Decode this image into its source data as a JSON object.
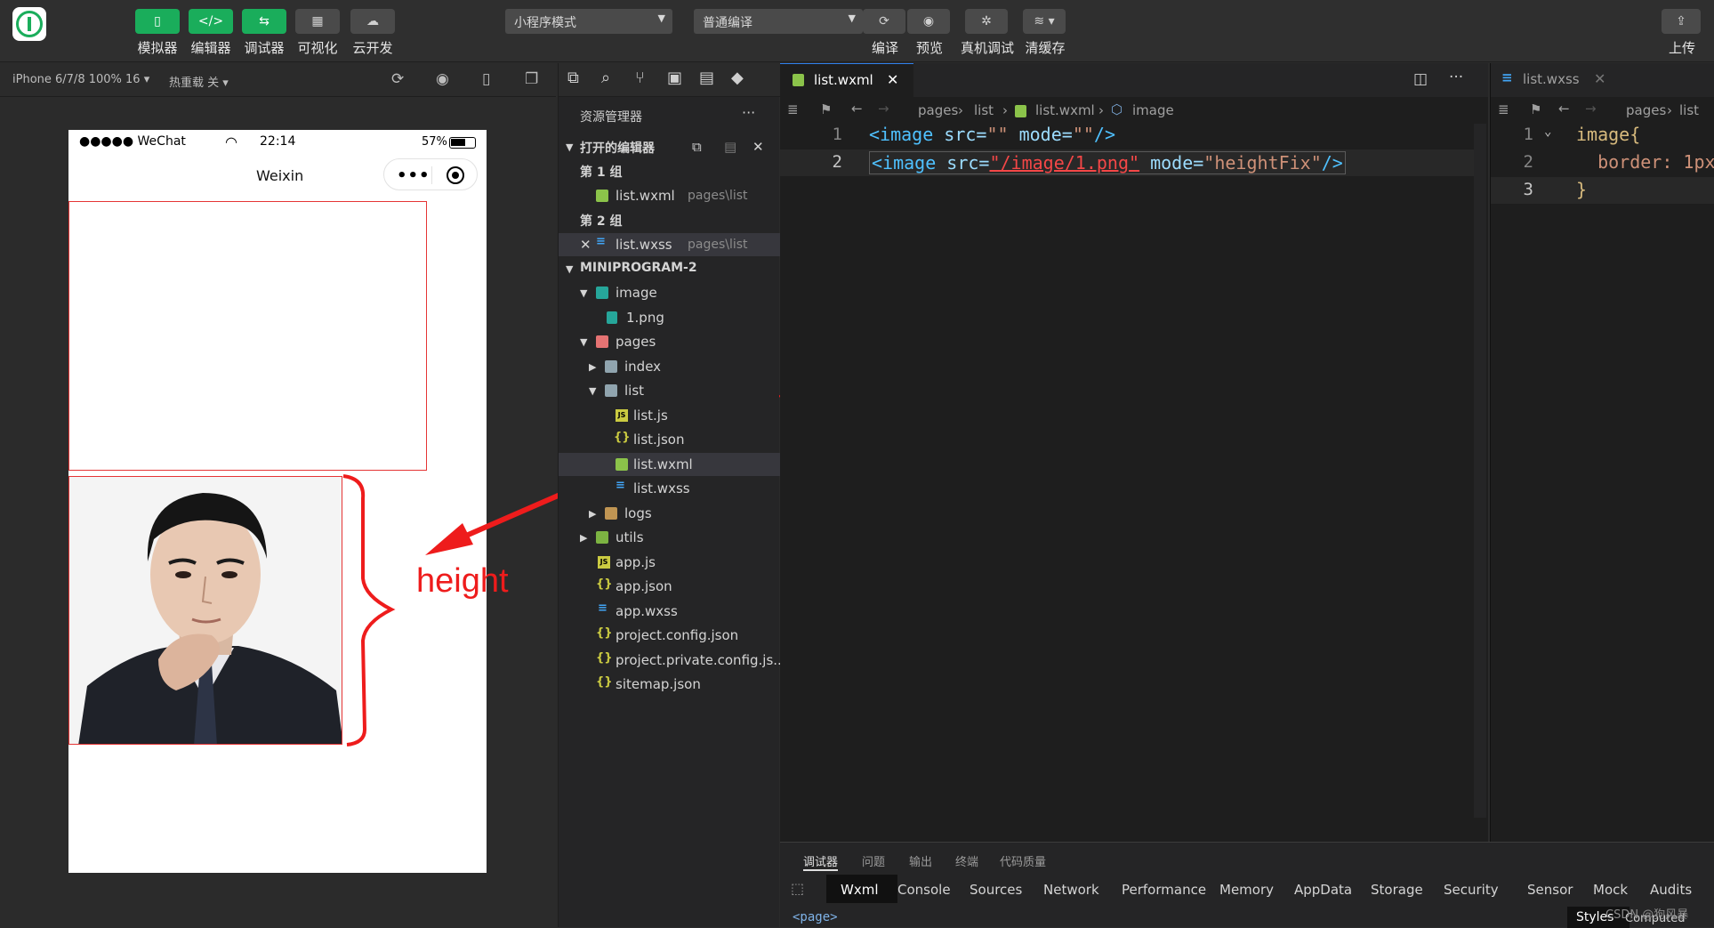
{
  "toolbar": {
    "buttons": [
      {
        "label": "模拟器",
        "icon": "phone-icon"
      },
      {
        "label": "编辑器",
        "icon": "code-icon"
      },
      {
        "label": "调试器",
        "icon": "debug-icon"
      },
      {
        "label": "可视化",
        "icon": "layout-icon"
      },
      {
        "label": "云开发",
        "icon": "cloud-icon"
      }
    ],
    "mode_select": "小程序模式",
    "compile_select": "普通编译",
    "actions": [
      {
        "label": "编译",
        "icon": "refresh-icon"
      },
      {
        "label": "预览",
        "icon": "eye-icon"
      },
      {
        "label": "真机调试",
        "icon": "bug-icon"
      },
      {
        "label": "清缓存",
        "icon": "layers-icon"
      }
    ],
    "upload_label": "上传"
  },
  "subbar": {
    "device": "iPhone 6/7/8 100% 16",
    "hot_reload": "热重载 关"
  },
  "simulator": {
    "signal": "●●●●● WeChat",
    "time": "22:14",
    "battery": "57%",
    "nav_title": "Weixin",
    "annotation_text": "height"
  },
  "explorer": {
    "title": "资源管理器",
    "more": "···",
    "open_editors": "打开的编辑器",
    "group1": "第 1 组",
    "group1_file": "list.wxml",
    "group1_path": "pages\\list",
    "group2": "第 2 组",
    "group2_file": "list.wxss",
    "group2_path": "pages\\list",
    "project": "MINIPROGRAM-2",
    "tree": [
      {
        "name": "image",
        "kind": "folder-img"
      },
      {
        "name": "1.png",
        "kind": "img"
      },
      {
        "name": "pages",
        "kind": "folder-red"
      },
      {
        "name": "index",
        "kind": "folder-blue"
      },
      {
        "name": "list",
        "kind": "folder-blue"
      },
      {
        "name": "list.js",
        "kind": "js"
      },
      {
        "name": "list.json",
        "kind": "json"
      },
      {
        "name": "list.wxml",
        "kind": "wxml"
      },
      {
        "name": "list.wxss",
        "kind": "css"
      },
      {
        "name": "logs",
        "kind": "folder"
      },
      {
        "name": "utils",
        "kind": "folder-green"
      },
      {
        "name": "app.js",
        "kind": "js"
      },
      {
        "name": "app.json",
        "kind": "json"
      },
      {
        "name": "app.wxss",
        "kind": "css"
      },
      {
        "name": "project.config.json",
        "kind": "json"
      },
      {
        "name": "project.private.config.js...",
        "kind": "json"
      },
      {
        "name": "sitemap.json",
        "kind": "json"
      }
    ]
  },
  "editor": {
    "tab": "list.wxml",
    "breadcrumb": [
      "pages",
      "list",
      "list.wxml",
      "image"
    ],
    "lines": [
      {
        "num": "1",
        "tag_open": "<image",
        "attr1": " src=",
        "val1": "\"\"",
        "attr2": " mode=",
        "val2": "\"\"",
        "close": "/>"
      },
      {
        "num": "2",
        "tag_open": "<image",
        "attr1": " src=",
        "val1": "\"/image/1.png\"",
        "attr2": " mode=",
        "val2": "\"heightFix\"",
        "close": "/>"
      }
    ]
  },
  "editor2": {
    "tab": "list.wxss",
    "breadcrumb": [
      "pages",
      "list"
    ],
    "lines": [
      {
        "num": "1",
        "text": "image{"
      },
      {
        "num": "2",
        "text": "  border: 1px"
      },
      {
        "num": "3",
        "text": "}"
      }
    ]
  },
  "devtools": {
    "top_tabs": [
      "调试器",
      "问题",
      "输出",
      "终端",
      "代码质量"
    ],
    "tabs": [
      "Wxml",
      "Console",
      "Sources",
      "Network",
      "Performance",
      "Memory",
      "AppData",
      "Storage",
      "Security",
      "Sensor",
      "Mock",
      "Audits"
    ],
    "node": "<page>",
    "styles": "Styles",
    "computed": "Computed",
    "watermark": "CSDN @狗风暴"
  }
}
